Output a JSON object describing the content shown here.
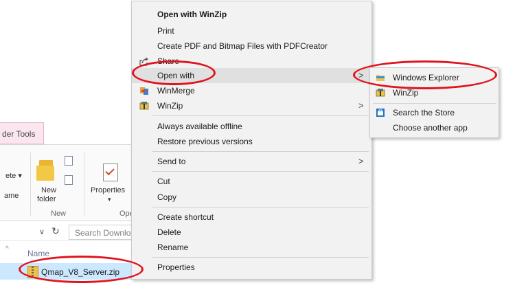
{
  "explorer": {
    "tool_tab": "der Tools",
    "ribbon": {
      "delete_partial": "ete ▾",
      "rename_partial": "ame",
      "new_folder_line1": "New",
      "new_folder_line2": "folder",
      "new_group": "New",
      "properties_label": "Properties",
      "properties_arrow": "▾",
      "open_group_partial": "Open"
    },
    "address": {
      "dropdown": "∨",
      "refresh": "↻",
      "search_placeholder": "Search Downloa"
    },
    "list": {
      "name_header_partial": "Name",
      "sort_arrow": "^",
      "selected_file": "Qmap_V8_Server.zip"
    }
  },
  "context_menu": {
    "items": [
      {
        "label": "Open with WinZip",
        "bold": true
      },
      {
        "label": "Print"
      },
      {
        "label": "Create PDF and Bitmap Files with PDFCreator"
      },
      {
        "label": "Share",
        "icon": "share-icon"
      },
      {
        "label": "Open with",
        "arrow": ">"
      },
      {
        "label": "WinMerge",
        "icon": "winmerge-icon"
      },
      {
        "label": "WinZip",
        "icon": "winzip-icon",
        "arrow": ">"
      },
      {
        "label": "Always available offline"
      },
      {
        "label": "Restore previous versions"
      },
      {
        "label": "Send to",
        "arrow": ">"
      },
      {
        "label": "Cut"
      },
      {
        "label": "Copy"
      },
      {
        "label": "Create shortcut"
      },
      {
        "label": "Delete"
      },
      {
        "label": "Rename"
      },
      {
        "label": "Properties"
      }
    ]
  },
  "open_with_submenu": {
    "items": [
      {
        "label": "Windows Explorer",
        "icon": "folder-icon"
      },
      {
        "label": "WinZip",
        "icon": "winzip-icon"
      },
      {
        "label": "Search the Store",
        "icon": "store-icon"
      },
      {
        "label": "Choose another app"
      }
    ]
  },
  "colors": {
    "annotation_red": "#e0141e",
    "menu_bg": "#f2f2f2",
    "highlight": "#e0e0e0",
    "selection": "#cce8ff"
  }
}
